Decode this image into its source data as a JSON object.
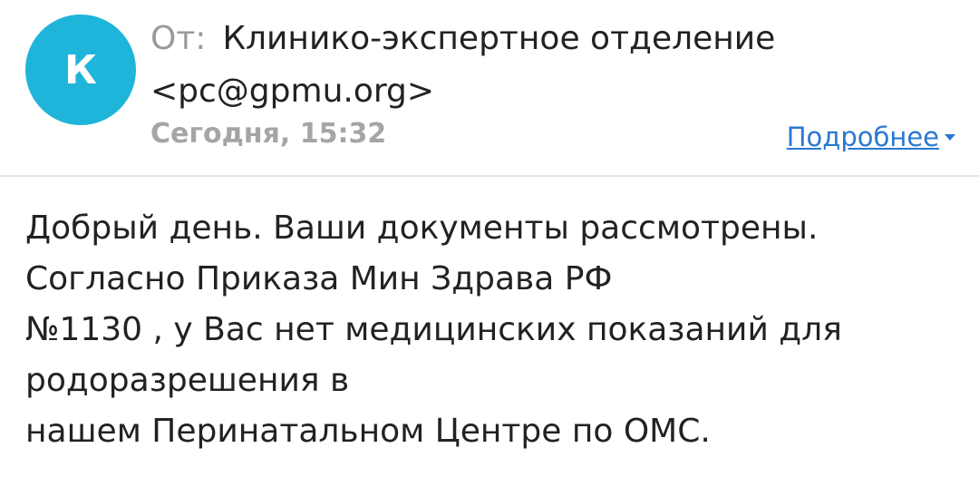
{
  "sender": {
    "avatar_letter": "К",
    "avatar_color": "#1fb4da",
    "from_label": "От:",
    "name": "Клинико-экспертное отделение",
    "email": "<pc@gpmu.org>"
  },
  "date": "Сегодня, 15:32",
  "details_link": "Подробнее",
  "message": {
    "lines": [
      "Добрый день. Ваши документы рассмотрены.",
      "Согласно Приказа Мин Здрава РФ",
      "№1130 , у Вас нет медицинских показаний для",
      "родоразрешения в",
      "нашем Перинатальном Центре по ОМС."
    ]
  }
}
